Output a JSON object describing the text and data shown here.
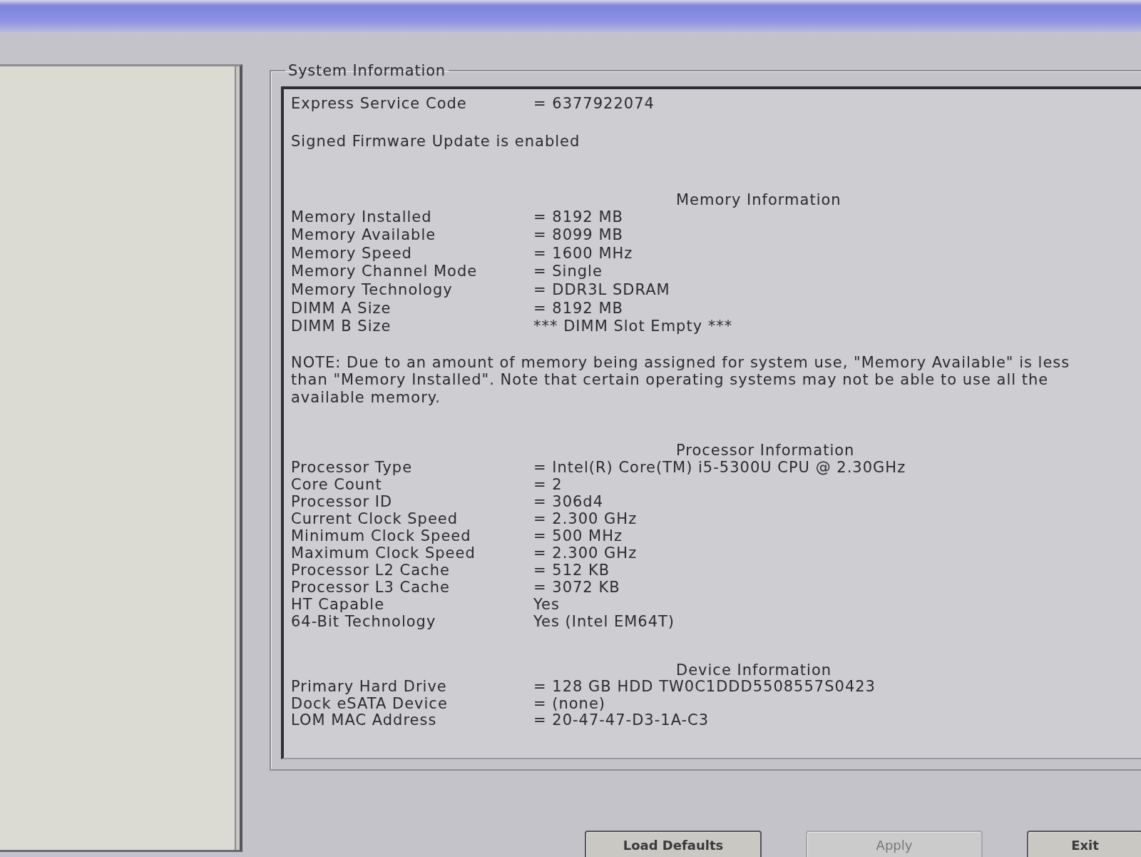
{
  "group_box": {
    "title": "System Information"
  },
  "service_code": {
    "label": "Express Service Code",
    "value": "= 6377922074"
  },
  "firmware_notice": "Signed Firmware Update is enabled",
  "sections": [
    {
      "heading": "Memory Information",
      "rows": [
        {
          "label": "Memory Installed",
          "value": "= 8192 MB"
        },
        {
          "label": "Memory Available",
          "value": "= 8099 MB"
        },
        {
          "label": "Memory Speed",
          "value": "= 1600 MHz"
        },
        {
          "label": "Memory Channel Mode",
          "value": "= Single"
        },
        {
          "label": "Memory Technology",
          "value": "= DDR3L SDRAM"
        },
        {
          "label": "DIMM A Size",
          "value": "= 8192 MB"
        },
        {
          "label": "DIMM B Size",
          "value": "*** DIMM Slot Empty ***"
        }
      ],
      "note": "NOTE: Due to an amount of memory being assigned for system use, \"Memory Available\" is less than \"Memory Installed\". Note that certain operating systems may not be able to use all the available memory."
    },
    {
      "heading": "Processor Information",
      "rows": [
        {
          "label": "Processor Type",
          "value": "= Intel(R) Core(TM) i5-5300U CPU @ 2.30GHz"
        },
        {
          "label": "Core Count",
          "value": "= 2"
        },
        {
          "label": "Processor ID",
          "value": "= 306d4"
        },
        {
          "label": "Current Clock Speed",
          "value": "= 2.300 GHz"
        },
        {
          "label": "Minimum Clock Speed",
          "value": "= 500 MHz"
        },
        {
          "label": "Maximum Clock Speed",
          "value": "= 2.300 GHz"
        },
        {
          "label": "Processor L2 Cache",
          "value": "= 512 KB"
        },
        {
          "label": "Processor L3 Cache",
          "value": "= 3072 KB"
        },
        {
          "label": "HT Capable",
          "value": "Yes"
        },
        {
          "label": "64-Bit Technology",
          "value": "Yes (Intel EM64T)"
        }
      ]
    },
    {
      "heading": "Device Information",
      "rows": [
        {
          "label": "Primary Hard Drive",
          "value": "= 128 GB HDD TW0C1DDD5508557S0423"
        },
        {
          "label": "Dock eSATA Device",
          "value": "= (none)"
        },
        {
          "label": "LOM MAC Address",
          "value": "= 20-47-47-D3-1A-C3"
        }
      ]
    }
  ],
  "buttons": [
    {
      "label": "Load Defaults",
      "disabled": false
    },
    {
      "label": "Apply",
      "disabled": true
    },
    {
      "label": "Exit",
      "disabled": false
    }
  ]
}
